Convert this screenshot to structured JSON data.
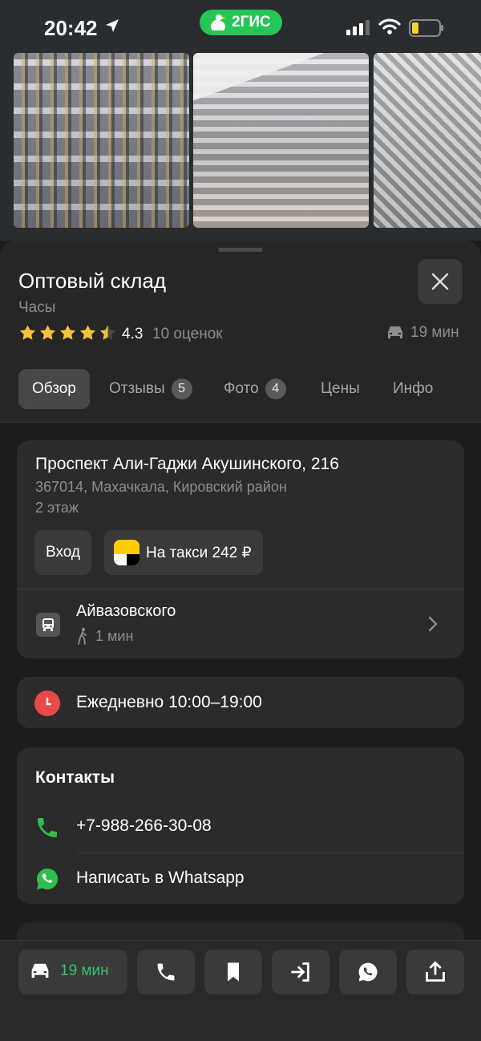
{
  "status_bar": {
    "time": "20:42",
    "brand": "2ГИС"
  },
  "place": {
    "title": "Оптовый склад",
    "category": "Часы",
    "rating": "4.3",
    "rating_stars_value": 4.3,
    "rating_count": "10 оценок",
    "drive_eta": "19 мин"
  },
  "tabs": [
    {
      "label": "Обзор"
    },
    {
      "label": "Отзывы",
      "badge": "5"
    },
    {
      "label": "Фото",
      "badge": "4"
    },
    {
      "label": "Цены"
    },
    {
      "label": "Инфо"
    }
  ],
  "address": {
    "line1": "Проспект Али-Гаджи Акушинского, 216",
    "line2": "367014, Махачкала, Кировский район",
    "floor": "2 этаж",
    "entry_label": "Вход",
    "taxi_label": "На такси 242 ₽",
    "stop_name": "Айвазовского",
    "walk_time": "1 мин"
  },
  "hours": {
    "text": "Ежедневно 10:00–19:00"
  },
  "contacts": {
    "title": "Контакты",
    "phone": "+7-988-266-30-08",
    "whatsapp": "Написать в Whatsapp"
  },
  "bottom_bar": {
    "route_eta": "19 мин"
  },
  "colors": {
    "accent_green": "#24c656",
    "star": "#f5c33b",
    "clock_red": "#e84a4a",
    "eta_green": "#36c463"
  }
}
